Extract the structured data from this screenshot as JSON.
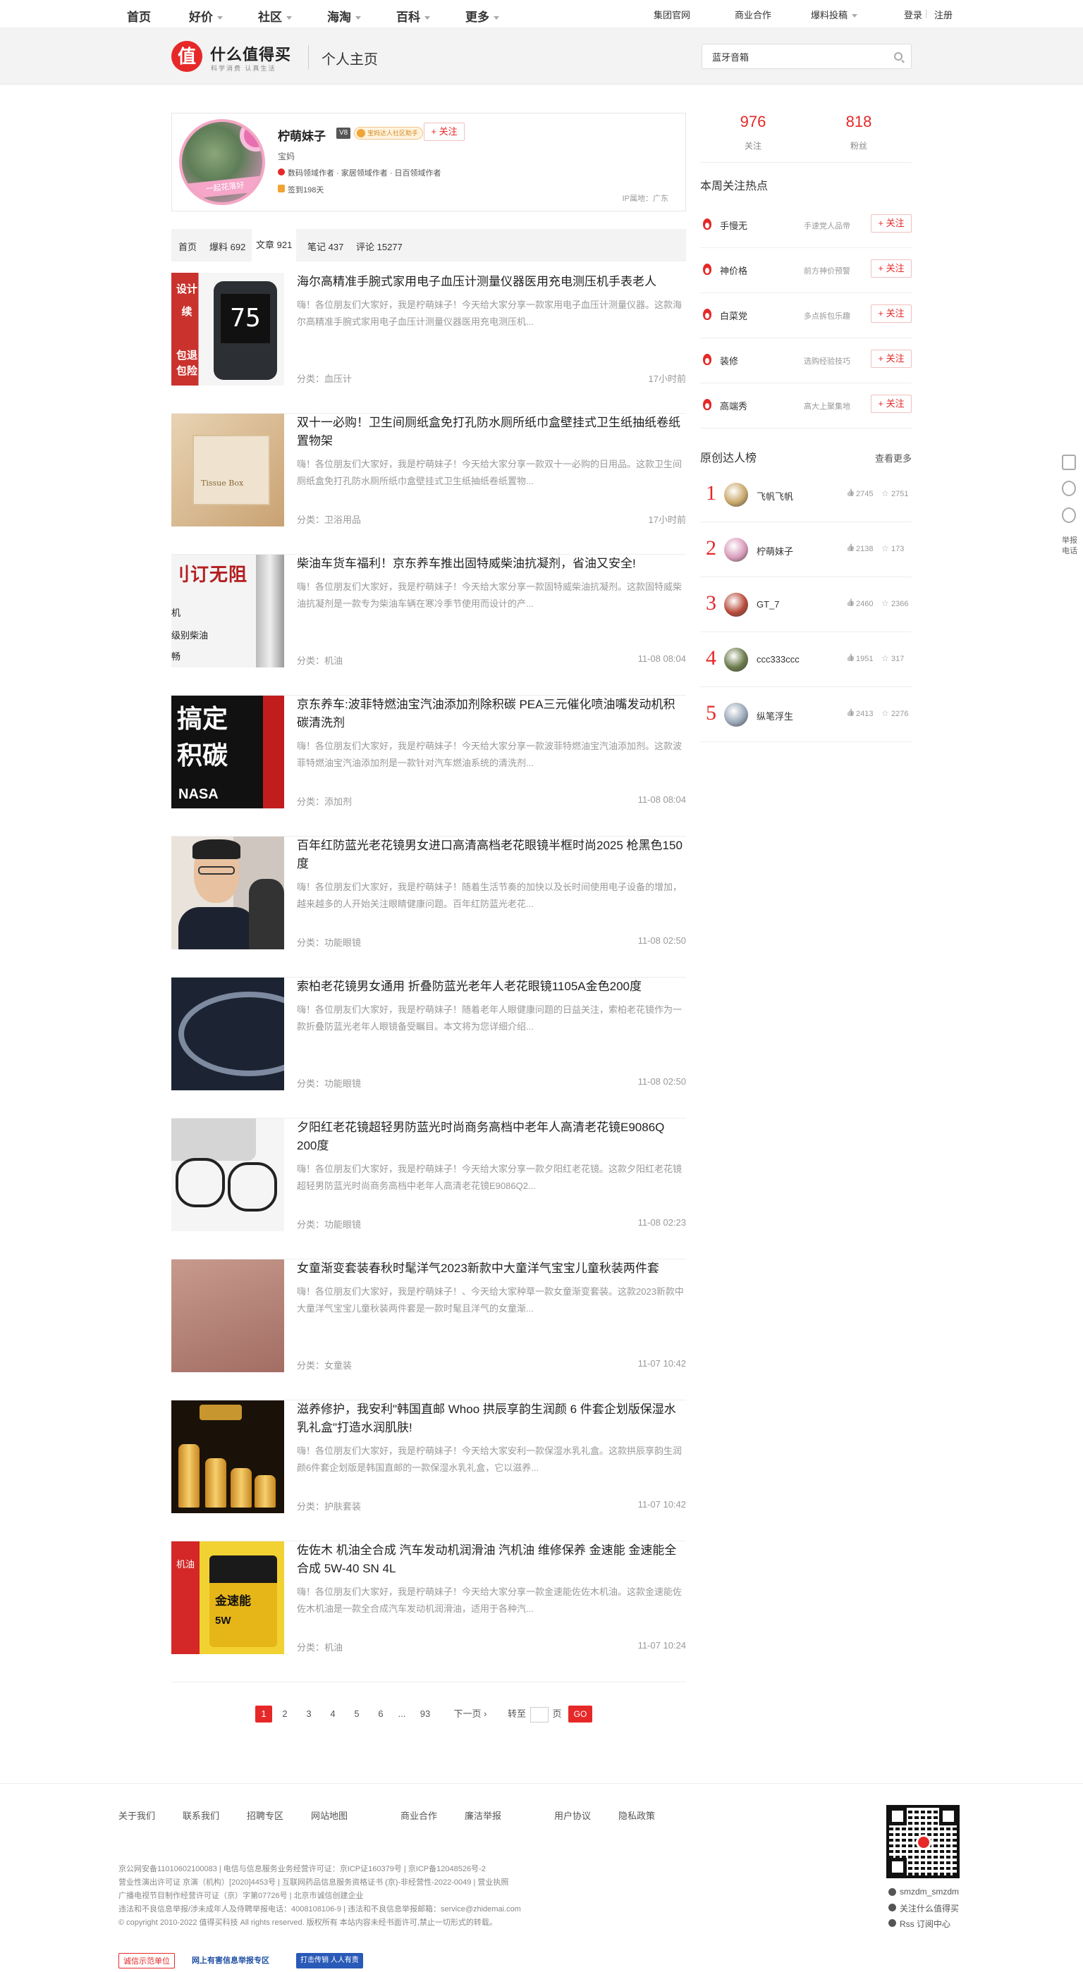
{
  "topnav": {
    "items": [
      "首页",
      "好价",
      "社区",
      "海淘",
      "百科",
      "更多"
    ],
    "right_links": [
      "集团官网",
      "商业合作",
      "爆料投稿",
      "登录",
      "注册"
    ]
  },
  "header": {
    "logo_char": "值",
    "logo_text": "什么值得买",
    "logo_sub": "科学消费 认真生活",
    "page_title": "个人主页",
    "search_value": "蓝牙音箱"
  },
  "profile": {
    "avatar_text": "一起花落好",
    "name": "柠萌妹子",
    "level": "V8",
    "honor": "宝妈达人社区助手",
    "follow_label": "+ 关注",
    "signature": "宝妈",
    "domains": "数码领域作者 · 家居领域作者 · 日百领域作者",
    "signin": "签到198天",
    "ip": "IP属地：广东"
  },
  "tabs": [
    "首页",
    "爆料 692",
    "文章 921",
    "笔记 437",
    "评论 15277"
  ],
  "articles": [
    {
      "title": "海尔高精准手腕式家用电子血压计测量仪器医用充电测压机手表老人",
      "summary": "嗨！各位朋友们大家好，我是柠萌妹子！今天给大家分享一款家用电子血压计测量仪器。这款海尔高精准手腕式家用电子血压计测量仪器医用充电测压机...",
      "category": "分类：血压计",
      "time": "17小时前",
      "thumb_text": [
        "设计",
        "续",
        "包退",
        "包险"
      ],
      "thumb_screen": "75"
    },
    {
      "title": "双十一必购！卫生间厕纸盒免打孔防水厕所纸巾盒壁挂式卫生纸抽纸卷纸置物架",
      "summary": "嗨！各位朋友们大家好，我是柠萌妹子！今天给大家分享一款双十一必购的日用品。这款卫生间厕纸盒免打孔防水厕所纸巾盒壁挂式卫生纸抽纸卷纸置物...",
      "category": "分类：卫浴用品",
      "time": "17小时前",
      "thumb_text": [
        "Tissue Box"
      ]
    },
    {
      "title": "柴油车货车福利！京东养车推出固特威柴油抗凝剂，省油又安全!",
      "summary": "嗨！各位朋友们大家好，我是柠萌妹子！今天给大家分享一款固特威柴油抗凝剂。这款固特威柴油抗凝剂是一款专为柴油车辆在寒冷季节使用而设计的产...",
      "category": "分类：机油",
      "time": "11-08 08:04",
      "thumb_text": [
        "刂订无阻",
        "机",
        "级别柴油",
        "畅"
      ]
    },
    {
      "title": "京东养车:波菲特燃油宝汽油添加剂除积碳 PEA三元催化喷油嘴发动机积碳清洗剂",
      "summary": "嗨！各位朋友们大家好，我是柠萌妹子！今天给大家分享一款波菲特燃油宝汽油添加剂。这款波菲特燃油宝汽油添加剂是一款针对汽车燃油系统的清洗剂...",
      "category": "分类：添加剂",
      "time": "11-08 08:04",
      "thumb_text": [
        "搞定",
        "积碳",
        "NASA"
      ]
    },
    {
      "title": "百年红防蓝光老花镜男女进口高清高档老花眼镜半框时尚2025 枪黑色150度",
      "summary": "嗨！各位朋友们大家好，我是柠萌妹子！随着生活节奏的加快以及长时间使用电子设备的增加，越来越多的人开始关注眼睛健康问题。百年红防蓝光老花...",
      "category": "分类：功能眼镜",
      "time": "11-08 02:50",
      "thumb_text": []
    },
    {
      "title": "索柏老花镜男女通用 折叠防蓝光老年人老花眼镜1105A金色200度",
      "summary": "嗨！各位朋友们大家好，我是柠萌妹子！随着老年人眼健康问题的日益关注，索柏老花镜作为一款折叠防蓝光老年人眼镜备受瞩目。本文将为您详细介绍...",
      "category": "分类：功能眼镜",
      "time": "11-08 02:50",
      "thumb_text": []
    },
    {
      "title": "夕阳红老花镜超轻男防蓝光时尚商务高档中老年人高清老花镜E9086Q 200度",
      "summary": "嗨！各位朋友们大家好，我是柠萌妹子！今天给大家分享一款夕阳红老花镜。这款夕阳红老花镜超轻男防蓝光时尚商务高档中老年人高清老花镜E9086Q2...",
      "category": "分类：功能眼镜",
      "time": "11-08 02:23",
      "thumb_text": []
    },
    {
      "title": "女童渐变套装春秋时髦洋气2023新款中大童洋气宝宝儿童秋装两件套",
      "summary": "嗨！各位朋友们大家好，我是柠萌妹子！、今天给大家种草一款女童渐变套装。这款2023新款中大童洋气宝宝儿童秋装两件套是一款时髦且洋气的女童渐...",
      "category": "分类：女童装",
      "time": "11-07 10:42",
      "thumb_text": []
    },
    {
      "title": "滋养修护，我安利\"韩国直邮 Whoo 拱辰享韵生润颜 6 件套企划版保湿水乳礼盒\"打造水润肌肤!",
      "summary": "嗨！各位朋友们大家好，我是柠萌妹子！今天给大家安利一款保湿水乳礼盒。这款拱辰享韵生润颜6件套企划版是韩国直邮的一款保湿水乳礼盒，它以滋养...",
      "category": "分类：护肤套装",
      "time": "11-07 10:42",
      "thumb_text": []
    },
    {
      "title": "佐佐木 机油全合成 汽车发动机润滑油 汽机油 维修保养 金速能 金速能全合成 5W-40 SN 4L",
      "summary": "嗨！各位朋友们大家好，我是柠萌妹子！今天给大家分享一款金速能佐佐木机油。这款金速能佐佐木机油是一款全合成汽车发动机润滑油，适用于各种汽...",
      "category": "分类：机油",
      "time": "11-07 10:24",
      "thumb_text": [
        "机油",
        "金速能",
        "5W"
      ]
    }
  ],
  "pagination": {
    "pages": [
      "1",
      "2",
      "3",
      "4",
      "5",
      "6",
      "...",
      "93"
    ],
    "next": "下一页 ›",
    "goto_label": "转至",
    "page_unit": "页",
    "go": "GO"
  },
  "stats": {
    "following": "976",
    "following_label": "关注",
    "fans": "818",
    "fans_label": "粉丝"
  },
  "hot": {
    "title": "本周关注热点",
    "follow_label": "+ 关注",
    "items": [
      {
        "name": "手慢无",
        "desc": "手速党人品帝"
      },
      {
        "name": "神价格",
        "desc": "前方神价预警"
      },
      {
        "name": "白菜党",
        "desc": "多点拆包乐趣"
      },
      {
        "name": "装修",
        "desc": "选购经验技巧"
      },
      {
        "name": "高端秀",
        "desc": "高大上聚集地"
      }
    ]
  },
  "ranking": {
    "title": "原创达人榜",
    "more": "查看更多",
    "items": [
      {
        "rank": "1",
        "name": "飞帆飞帆",
        "likes": "2745",
        "favs": "2751",
        "color": "#c9a86a"
      },
      {
        "rank": "2",
        "name": "柠萌妹子",
        "likes": "2138",
        "favs": "173",
        "color": "#d99bbb"
      },
      {
        "rank": "3",
        "name": "GT_7",
        "likes": "2460",
        "favs": "2366",
        "color": "#b84a3a"
      },
      {
        "rank": "4",
        "name": "ccc333ccc",
        "likes": "1951",
        "favs": "317",
        "color": "#6b7a4a"
      },
      {
        "rank": "5",
        "name": "纵笔浮生",
        "likes": "2413",
        "favs": "2276",
        "color": "#9aa7b8"
      }
    ]
  },
  "side": {
    "report": "举报\n电话"
  },
  "footer": {
    "links": [
      "关于我们",
      "联系我们",
      "招聘专区",
      "网站地图",
      "商业合作",
      "廉洁举报",
      "用户协议",
      "隐私政策"
    ],
    "lines": [
      "京公网安备11010602100083 | 电信与信息服务业务经营许可证：京ICP证160379号 | 京ICP备12048526号-2",
      "营业性演出许可证 京演（机构）[2020]4453号 | 互联网药品信息服务资格证书 (京)-非经营性-2022-0049 | 营业执照",
      "广播电视节目制作经营许可证（京）字第07726号 | 北京市诚信创建企业",
      "违法和不良信息举报/涉未成年人及侍聘举报电话：4008108106-9 | 违法和不良信息举报邮箱：service@zhidemai.com",
      "© copyright 2010-2022 值得买科技 All rights reserved. 版权所有 本站内容未经书面许可,禁止一切形式的转载。"
    ],
    "right": [
      "smzdm_smzdm",
      "关注什么值得买",
      "Rss 订阅中心"
    ],
    "badges": [
      "诚信示范单位",
      "网上有害信息举报专区",
      "打击传销 人人有责"
    ],
    "brand_red": "#e62828"
  }
}
